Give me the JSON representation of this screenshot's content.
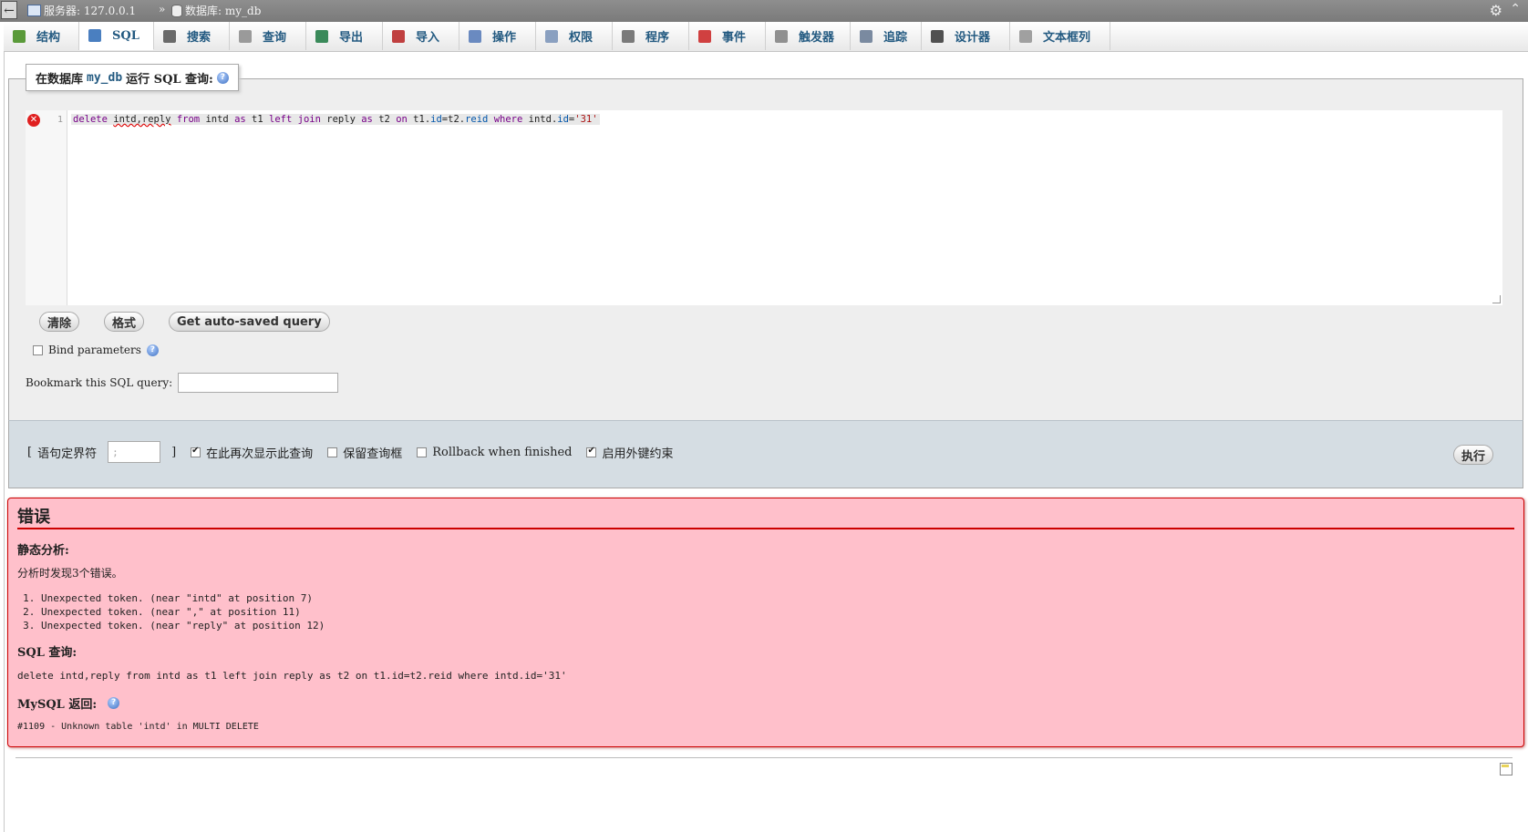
{
  "topbar": {
    "server_label": "服务器: 127.0.0.1",
    "separator": "»",
    "database_label": "数据库: my_db"
  },
  "tabs": [
    {
      "label": "结构",
      "icon": "structure-icon",
      "color": "#5a9a3a"
    },
    {
      "label": "SQL",
      "icon": "sql-icon",
      "color": "#4a7fc0"
    },
    {
      "label": "搜索",
      "icon": "search-icon",
      "color": "#6a6a6a"
    },
    {
      "label": "查询",
      "icon": "query-icon",
      "color": "#9a9a9a"
    },
    {
      "label": "导出",
      "icon": "export-icon",
      "color": "#3a8a5a"
    },
    {
      "label": "导入",
      "icon": "import-icon",
      "color": "#c04040"
    },
    {
      "label": "操作",
      "icon": "wrench-icon",
      "color": "#6a8ac0"
    },
    {
      "label": "权限",
      "icon": "privileges-icon",
      "color": "#8aa0c0"
    },
    {
      "label": "程序",
      "icon": "routines-icon",
      "color": "#7a7a7a"
    },
    {
      "label": "事件",
      "icon": "clock-icon",
      "color": "#d04040"
    },
    {
      "label": "触发器",
      "icon": "trigger-icon",
      "color": "#909090"
    },
    {
      "label": "追踪",
      "icon": "eye-icon",
      "color": "#7a8aa0"
    },
    {
      "label": "设计器",
      "icon": "designer-icon",
      "color": "#505050"
    },
    {
      "label": "文本框列",
      "icon": "columns-icon",
      "color": "#a0a0a0"
    }
  ],
  "query_box": {
    "legend_prefix": "在数据库",
    "legend_db": "my_db",
    "legend_suffix": "运行 SQL 查询:",
    "line_number": "1",
    "code": {
      "t1": "delete",
      "t2": "intd,reply",
      "t3": "from",
      "t4": "intd",
      "t5": "as",
      "t6": "t1",
      "t7": "left",
      "t8": "join",
      "t9": "reply",
      "t10": "as",
      "t11": "t2",
      "t12": "on",
      "t13": "t1.",
      "t14": "id",
      "t15": "=t2.",
      "t16": "reid",
      "t17": "where",
      "t18": "intd.",
      "t19": "id",
      "t20": "=",
      "t21": "'31'"
    },
    "btn_clear": "清除",
    "btn_format": "格式",
    "btn_autosave": "Get auto-saved query",
    "bind_params_label": "Bind parameters",
    "bookmark_label": "Bookmark this SQL query:",
    "bookmark_value": ""
  },
  "options": {
    "delimiter_open": "[",
    "delimiter_label": "语句定界符",
    "delimiter_value": ";",
    "delimiter_close": "]",
    "show_again_label": "在此再次显示此查询",
    "show_again_checked": true,
    "retain_box_label": "保留查询框",
    "retain_box_checked": false,
    "rollback_label": "Rollback when finished",
    "rollback_checked": false,
    "fk_label": "启用外键约束",
    "fk_checked": true,
    "go_button": "执行"
  },
  "error": {
    "title": "错误",
    "static_analysis_heading": "静态分析:",
    "found_text": "分析时发现3个错误。",
    "items": [
      "Unexpected token. (near \"intd\" at position 7)",
      "Unexpected token. (near \",\" at position 11)",
      "Unexpected token. (near \"reply\" at position 12)"
    ],
    "sql_heading": "SQL 查询:",
    "sql_text": "delete intd,reply from intd as t1 left join reply as t2 on t1.id=t2.reid where intd.id='31'",
    "mysql_heading": "MySQL 返回:",
    "mysql_message": "#1109 - Unknown table 'intd' in MULTI DELETE"
  }
}
